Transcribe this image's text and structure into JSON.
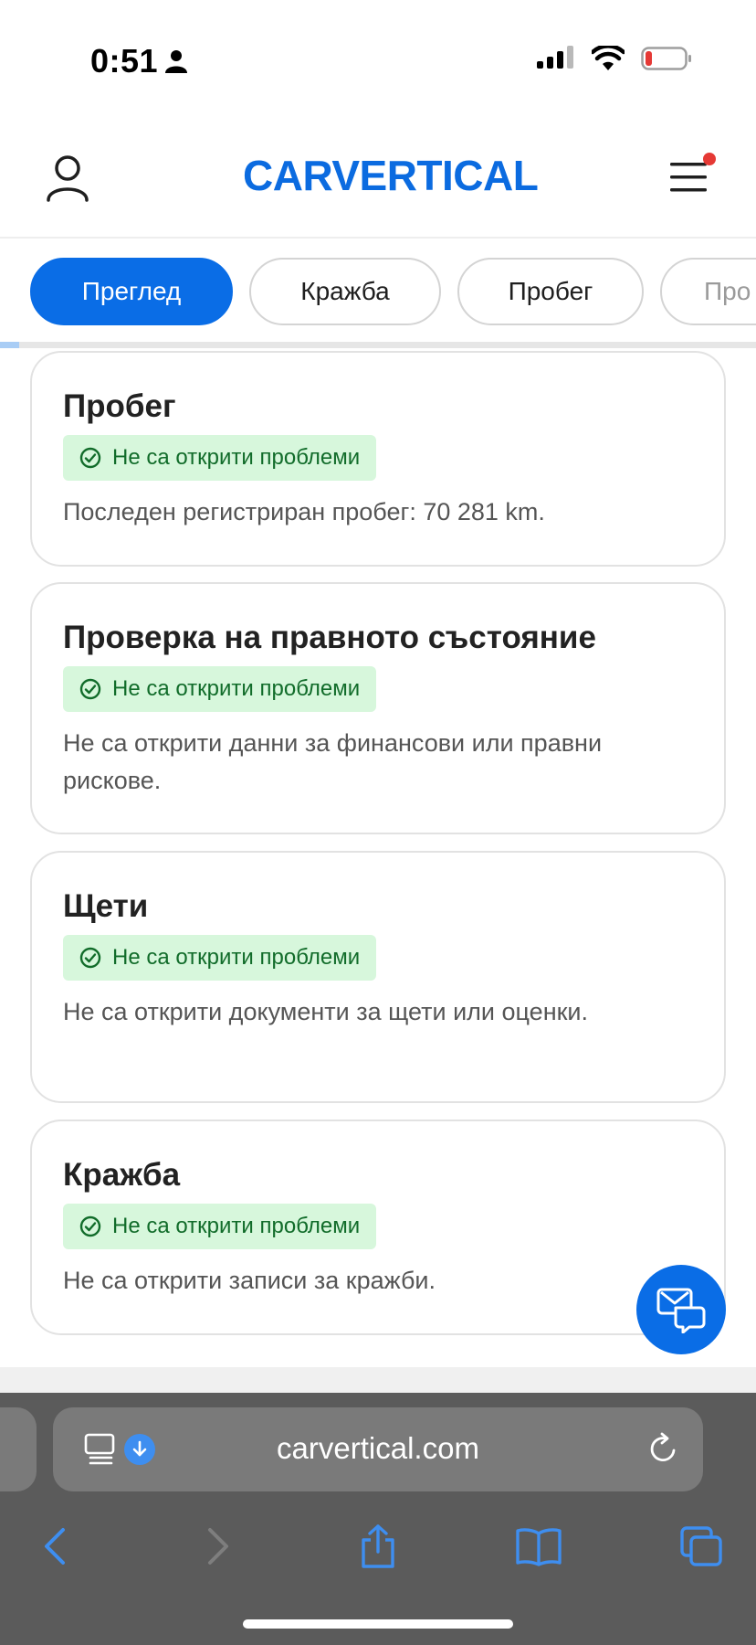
{
  "status_bar": {
    "time": "0:51",
    "icons": [
      "person-icon",
      "cellular-icon",
      "wifi-icon",
      "battery-low-icon"
    ],
    "battery_color": "#e53935"
  },
  "header": {
    "logo": "CARVERTICAL",
    "logo_color": "#0b6be0",
    "icons": [
      "user-icon",
      "hamburger-menu-icon"
    ],
    "notification_dot_color": "#e53935"
  },
  "tabs": [
    {
      "label": "Преглед",
      "active": true
    },
    {
      "label": "Кражба",
      "active": false
    },
    {
      "label": "Пробег",
      "active": false
    },
    {
      "label": "Про",
      "active": false
    }
  ],
  "tabs_scroll_progress": 0.025,
  "cards": [
    {
      "title": "Пробег",
      "status": "Не са открити проблеми",
      "text": "Последен регистриран пробег: 70 281 km."
    },
    {
      "title": "Проверка на правното състояние",
      "status": "Не са открити проблеми",
      "text": "Не са открити данни за финансови или правни рискове."
    },
    {
      "title": "Щети",
      "status": "Не са открити проблеми",
      "text": "Не са открити документи за щети или оценки."
    },
    {
      "title": "Кражба",
      "status": "Не са открити проблеми",
      "text": "Не са открити записи за кражби."
    }
  ],
  "chat_fab": {
    "icon": "chat-icon"
  },
  "browser": {
    "url": "carvertical.com",
    "icons": [
      "reader-icon",
      "download-icon",
      "reload-icon",
      "back-icon",
      "forward-icon",
      "share-icon",
      "bookmarks-icon",
      "tabs-icon"
    ]
  },
  "colors": {
    "accent": "#0a6de6",
    "badge_bg": "#d7f7dc",
    "badge_text": "#116c2a"
  }
}
